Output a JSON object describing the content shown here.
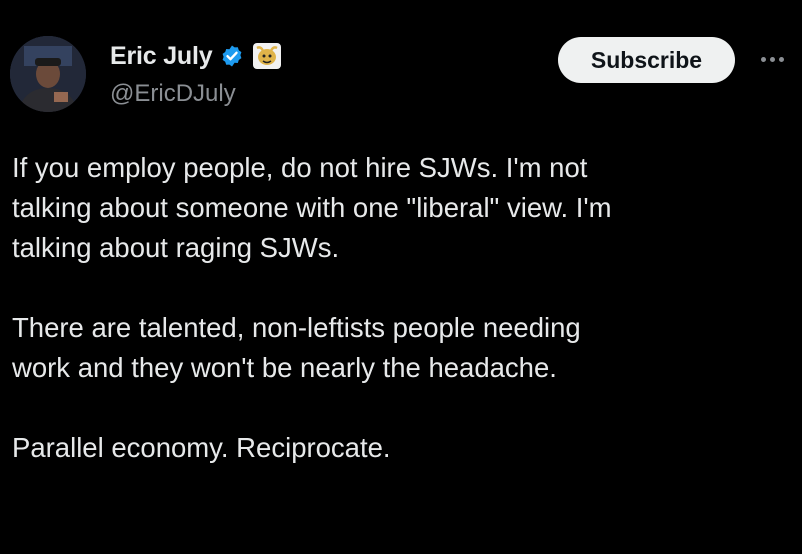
{
  "author": {
    "name": "Eric July",
    "handle": "@EricDJuly",
    "avatar_icon": "profile-avatar-icon",
    "verified_icon": "verified-badge-icon",
    "affiliate_icon": "affiliate-badge-icon"
  },
  "actions": {
    "subscribe_label": "Subscribe",
    "more_icon": "more-options-icon"
  },
  "tweet": {
    "paragraphs": [
      "If you employ people, do not hire SJWs. I'm not\ntalking about someone with one \"liberal\" view. I'm\ntalking about raging SJWs.",
      "There are talented, non-leftists people needing\nwork and they won't be nearly the headache.",
      "Parallel economy. Reciprocate."
    ]
  },
  "colors": {
    "background": "#000000",
    "text": "#e7e9ea",
    "secondary_text": "#8b8f94",
    "verified_blue": "#1d9bf0",
    "button_bg": "#eff1f1",
    "button_text": "#0f1419"
  }
}
